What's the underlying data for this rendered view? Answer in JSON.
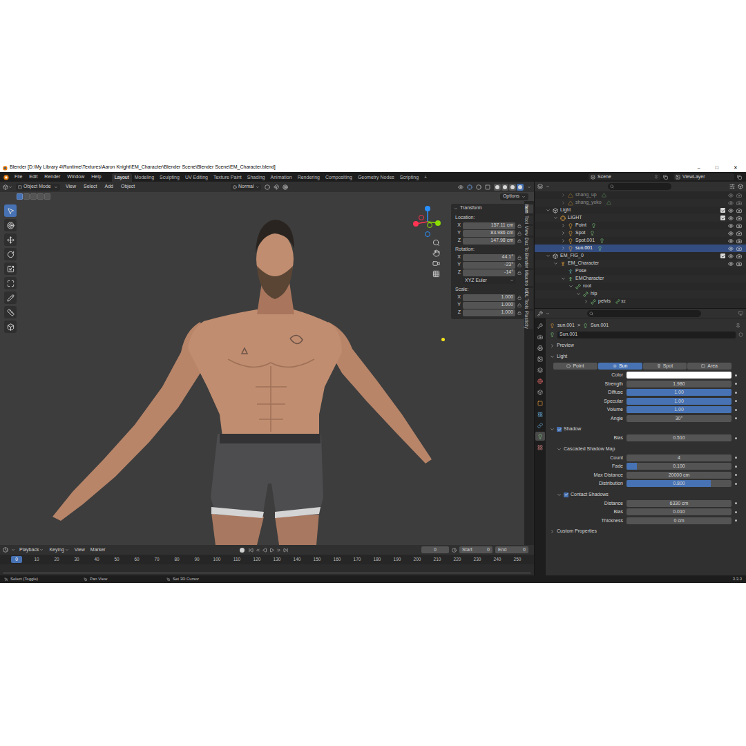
{
  "window": {
    "title": "Blender [D:\\My Library 4\\Runtime\\Textures\\Aaron Knight\\EM_Character\\Blender Scene\\Blender Scene\\EM_Character.blend]",
    "controls": [
      "–",
      "□",
      "✕"
    ]
  },
  "menu": [
    "File",
    "Edit",
    "Render",
    "Window",
    "Help"
  ],
  "workspaces": [
    {
      "label": "Layout",
      "selected": true
    },
    {
      "label": "Modeling",
      "selected": false
    },
    {
      "label": "Sculpting",
      "selected": false
    },
    {
      "label": "UV Editing",
      "selected": false
    },
    {
      "label": "Texture Paint",
      "selected": false
    },
    {
      "label": "Shading",
      "selected": false
    },
    {
      "label": "Animation",
      "selected": false
    },
    {
      "label": "Rendering",
      "selected": false
    },
    {
      "label": "Compositing",
      "selected": false
    },
    {
      "label": "Geometry Nodes",
      "selected": false
    },
    {
      "label": "Scripting",
      "selected": false
    }
  ],
  "add_workspace": "+",
  "scene": "Scene",
  "view_layer": "ViewLayer",
  "viewport": {
    "mode": "Object Mode",
    "menus": [
      "View",
      "Select",
      "Add",
      "Object"
    ],
    "orientation": "Normal",
    "options": "Options",
    "select_modes": [
      {
        "selected": true
      },
      {
        "selected": false
      },
      {
        "selected": false
      },
      {
        "selected": false
      },
      {
        "selected": false
      }
    ],
    "tools": [
      {
        "selected": true
      },
      {
        "selected": false
      },
      {
        "selected": false
      },
      {
        "selected": false
      },
      {
        "selected": false
      },
      {
        "selected": false
      },
      {
        "selected": false
      },
      {
        "selected": false
      },
      {
        "selected": false
      }
    ],
    "shading": [
      {
        "selected": false
      },
      {
        "selected": false
      },
      {
        "selected": false
      },
      {
        "selected": true
      }
    ]
  },
  "transform": {
    "title": "Transform",
    "groups": [
      {
        "label": "Location:",
        "fields": [
          {
            "axis": "X",
            "value": "157.11 cm"
          },
          {
            "axis": "Y",
            "value": "83.986 cm"
          },
          {
            "axis": "Z",
            "value": "147.98 cm"
          }
        ]
      },
      {
        "label": "Rotation:",
        "fields": [
          {
            "axis": "X",
            "value": "44.1°"
          },
          {
            "axis": "Y",
            "value": "-23°"
          },
          {
            "axis": "Z",
            "value": "-14°"
          }
        ],
        "mode": "XYZ Euler"
      },
      {
        "label": "Scale:",
        "fields": [
          {
            "axis": "X",
            "value": "1.000"
          },
          {
            "axis": "Y",
            "value": "1.000"
          },
          {
            "axis": "Z",
            "value": "1.000"
          }
        ]
      }
    ]
  },
  "sidebar_tabs": [
    {
      "label": "Item",
      "selected": true
    },
    {
      "label": "Tool",
      "selected": false
    },
    {
      "label": "View",
      "selected": false
    },
    {
      "label": "Daz To Blender",
      "selected": false
    },
    {
      "label": "Mixamo",
      "selected": false
    },
    {
      "label": "MDL Tools",
      "selected": false
    },
    {
      "label": "Plasticity",
      "selected": false
    }
  ],
  "timeline": {
    "menus": [
      {
        "label": "Playback",
        "dropdown": true
      },
      {
        "label": "Keying",
        "dropdown": true
      },
      {
        "label": "View",
        "dropdown": false
      },
      {
        "label": "Marker",
        "dropdown": false
      }
    ],
    "frame": "0",
    "start_label": "Start",
    "start": "0",
    "end_label": "End",
    "end": "0",
    "current": "0",
    "ruler": [
      "0",
      "10",
      "20",
      "30",
      "40",
      "50",
      "60",
      "70",
      "80",
      "90",
      "100",
      "110",
      "120",
      "130",
      "140",
      "150",
      "160",
      "170",
      "180",
      "190",
      "200",
      "210",
      "220",
      "230",
      "240",
      "250"
    ]
  },
  "outliner": {
    "rows": [
      {
        "label": "shang_up",
        "depth": 3,
        "kind": "mesh",
        "expanded": false,
        "selected": false,
        "faded": true,
        "visible": true
      },
      {
        "label": "shang_yoko",
        "depth": 3,
        "kind": "mesh",
        "expanded": false,
        "selected": false,
        "faded": true,
        "visible": true
      },
      {
        "label": "Light",
        "depth": 1,
        "kind": "collection",
        "expanded": true,
        "selected": false,
        "faded": false,
        "checked": true,
        "visible": true
      },
      {
        "label": "LIGHT",
        "depth": 2,
        "kind": "empty",
        "expanded": true,
        "selected": false,
        "faded": false,
        "checked": true,
        "visible": true
      },
      {
        "label": "Point",
        "depth": 3,
        "kind": "light",
        "expanded": false,
        "selected": false,
        "faded": false,
        "visible": true
      },
      {
        "label": "Spot",
        "depth": 3,
        "kind": "light",
        "expanded": false,
        "selected": false,
        "faded": false,
        "visible": true
      },
      {
        "label": "Spot.001",
        "depth": 3,
        "kind": "light",
        "expanded": false,
        "selected": false,
        "faded": false,
        "visible": true
      },
      {
        "label": "sun.001",
        "depth": 3,
        "kind": "light",
        "expanded": false,
        "selected": true,
        "faded": false,
        "visible": true
      },
      {
        "label": "EM_FIG_0",
        "depth": 1,
        "kind": "collection",
        "expanded": true,
        "selected": false,
        "faded": false,
        "checked": true,
        "visible": true
      },
      {
        "label": "EM_Character",
        "depth": 2,
        "kind": "armature",
        "expanded": true,
        "selected": false,
        "faded": false,
        "visible": true
      },
      {
        "label": "Pose",
        "depth": 3,
        "kind": "pose",
        "expanded": false,
        "selected": false,
        "faded": false
      },
      {
        "label": "EMCharacter",
        "depth": 3,
        "kind": "armature_data",
        "expanded": true,
        "selected": false,
        "faded": false
      },
      {
        "label": "root",
        "depth": 4,
        "kind": "bone",
        "expanded": true,
        "selected": false,
        "faded": false
      },
      {
        "label": "hip",
        "depth": 5,
        "kind": "bone",
        "expanded": true,
        "selected": false,
        "faded": false
      },
      {
        "label": "pelvis",
        "depth": 6,
        "kind": "bone",
        "expanded": false,
        "selected": false,
        "faded": false,
        "badge": "32"
      }
    ]
  },
  "properties": {
    "breadcrumb": [
      "sun.001",
      "Sun.001"
    ],
    "separator": ">",
    "name": "Sun.001",
    "tabs": [
      {
        "selected": false
      },
      {
        "selected": false
      },
      {
        "selected": false
      },
      {
        "selected": false
      },
      {
        "selected": false
      },
      {
        "selected": false
      },
      {
        "selected": false
      },
      {
        "selected": false
      },
      {
        "selected": false
      },
      {
        "selected": false
      },
      {
        "selected": true
      },
      {
        "selected": false
      }
    ],
    "sections": [
      {
        "title": "Preview",
        "expanded": false,
        "depth": 0,
        "fields": []
      },
      {
        "title": "Light",
        "expanded": true,
        "depth": 0,
        "types": [
          {
            "label": "Point",
            "selected": false
          },
          {
            "label": "Sun",
            "selected": true
          },
          {
            "label": "Spot",
            "selected": false
          },
          {
            "label": "Area",
            "selected": false
          }
        ],
        "fields": [
          {
            "label": "Color",
            "kind": "color",
            "color": "#ffffff"
          },
          {
            "label": "Strength",
            "kind": "number",
            "value": "1.980"
          },
          {
            "label": "Diffuse",
            "kind": "slider",
            "value": "1.00",
            "level": 1
          },
          {
            "label": "Specular",
            "kind": "slider",
            "value": "1.00",
            "level": 1
          },
          {
            "label": "Volume",
            "kind": "slider",
            "value": "1.00",
            "level": 1
          },
          {
            "label": "Angle",
            "kind": "number",
            "value": "30°"
          }
        ]
      },
      {
        "title": "Shadow",
        "expanded": true,
        "depth": 0,
        "checked": true,
        "fields": [
          {
            "label": "Bias",
            "kind": "number",
            "value": "0.510"
          }
        ]
      },
      {
        "title": "Cascaded Shadow Map",
        "expanded": true,
        "depth": 1,
        "fields": [
          {
            "label": "Count",
            "kind": "number",
            "value": "4"
          },
          {
            "label": "Fade",
            "kind": "slider",
            "value": "0.100",
            "level": 0.1
          },
          {
            "label": "Max Distance",
            "kind": "number",
            "value": "20000 cm"
          },
          {
            "label": "Distribution",
            "kind": "slider",
            "value": "0.800",
            "level": 0.8
          }
        ]
      },
      {
        "title": "Contact Shadows",
        "expanded": true,
        "depth": 1,
        "checked": true,
        "fields": [
          {
            "label": "Distance",
            "kind": "number",
            "value": "6330 cm"
          },
          {
            "label": "Bias",
            "kind": "number",
            "value": "0.010"
          },
          {
            "label": "Thickness",
            "kind": "number",
            "value": "0 cm"
          }
        ]
      },
      {
        "title": "Custom Properties",
        "expanded": false,
        "depth": 0,
        "fields": []
      }
    ]
  },
  "status_bar": {
    "hints": [
      "Select (Toggle)",
      "Pan View",
      "Set 3D Cursor"
    ],
    "version": "3.3.3"
  }
}
